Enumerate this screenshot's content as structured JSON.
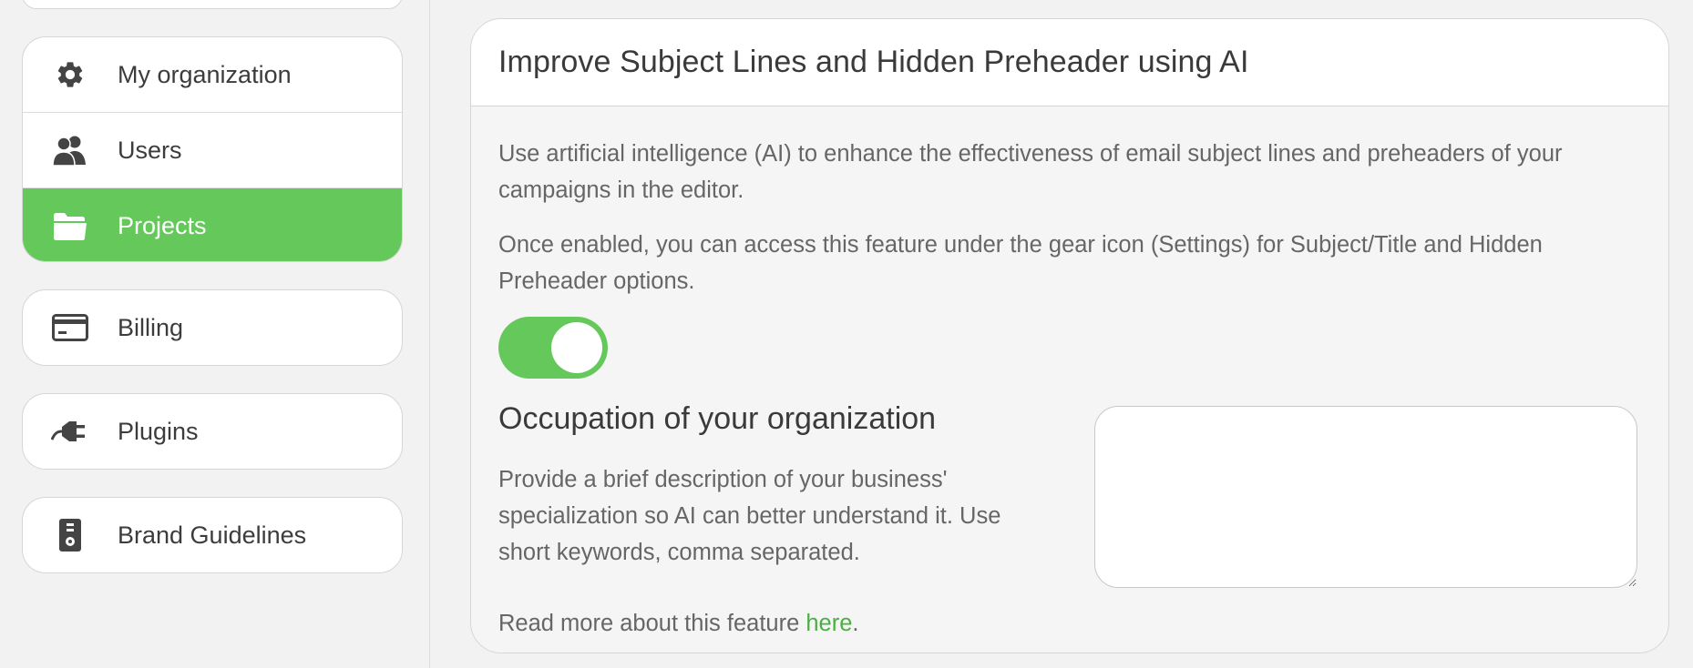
{
  "sidebar": {
    "group": [
      {
        "label": "My organization",
        "icon": "gear-icon",
        "active": false
      },
      {
        "label": "Users",
        "icon": "users-icon",
        "active": false
      },
      {
        "label": "Projects",
        "icon": "folder-icon",
        "active": true
      }
    ],
    "billing": {
      "label": "Billing",
      "icon": "credit-card-icon"
    },
    "plugins": {
      "label": "Plugins",
      "icon": "plug-icon"
    },
    "brand": {
      "label": "Brand Guidelines",
      "icon": "brand-book-icon"
    }
  },
  "main": {
    "title": "Improve Subject Lines and Hidden Preheader using AI",
    "paragraph1": "Use artificial intelligence (AI) to enhance the effectiveness of email subject lines and preheaders of your campaigns in the editor.",
    "paragraph2": "Once enabled, you can access this feature under the gear icon (Settings) for Subject/Title and Hidden Preheader options.",
    "toggle_enabled": true,
    "occupation": {
      "title": "Occupation of your organization",
      "description": "Provide a brief description of your business' specialization so AI can better understand it. Use short keywords, comma separated.",
      "value": ""
    },
    "read_more": {
      "prefix": "Read more about this feature ",
      "link": "here",
      "suffix": "."
    }
  },
  "colors": {
    "accent": "#65c85a",
    "link": "#4cae44"
  }
}
